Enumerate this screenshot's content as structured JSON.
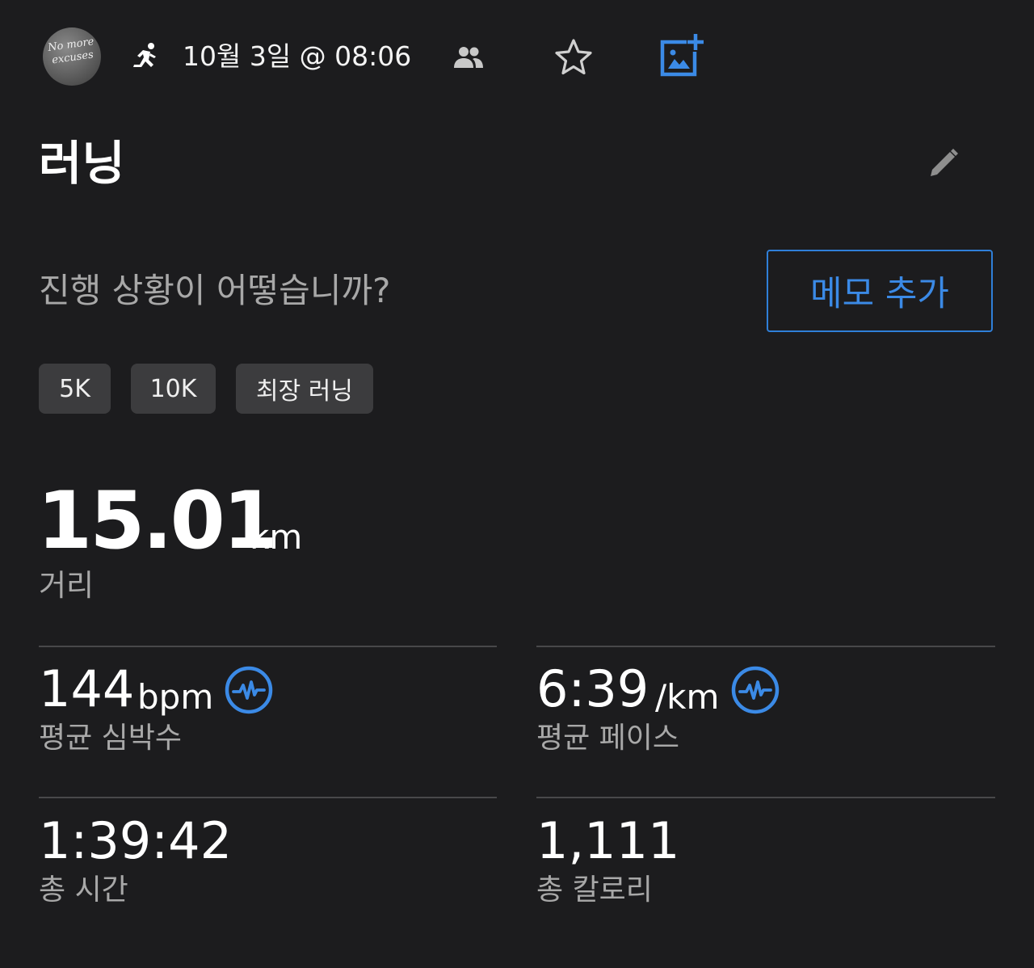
{
  "header": {
    "avatar_text": "No more excuses",
    "activity_icon": "running-person-icon",
    "date": "10월 3일 @ 08:06",
    "privacy_icon": "people-icon",
    "favorite_icon": "star-outline-icon",
    "add_photo_icon": "add-photo-icon"
  },
  "activity": {
    "title": "러닝",
    "edit_icon": "pencil-icon"
  },
  "notes": {
    "prompt": "진행 상황이 어떻습니까?",
    "add_memo_label": "메모 추가"
  },
  "badges": [
    "5K",
    "10K",
    "최장 러닝"
  ],
  "distance": {
    "value": "15.01",
    "unit": "km",
    "label": "거리"
  },
  "stats": {
    "heart_rate": {
      "value": "144",
      "unit": "bpm",
      "label": "평균 심박수",
      "icon": "heart-rate-graph-icon"
    },
    "pace": {
      "value": "6:39",
      "unit": "/km",
      "label": "평균 페이스",
      "icon": "heart-rate-graph-icon"
    },
    "time": {
      "value": "1:39:42",
      "label": "총 시간"
    },
    "calories": {
      "value": "1,111",
      "label": "총 칼로리"
    }
  },
  "colors": {
    "background": "#1c1c1e",
    "accent": "#3b8ae6",
    "chip": "#3c3c3e",
    "divider": "#48484a",
    "secondary_text": "#a8a8a8"
  }
}
